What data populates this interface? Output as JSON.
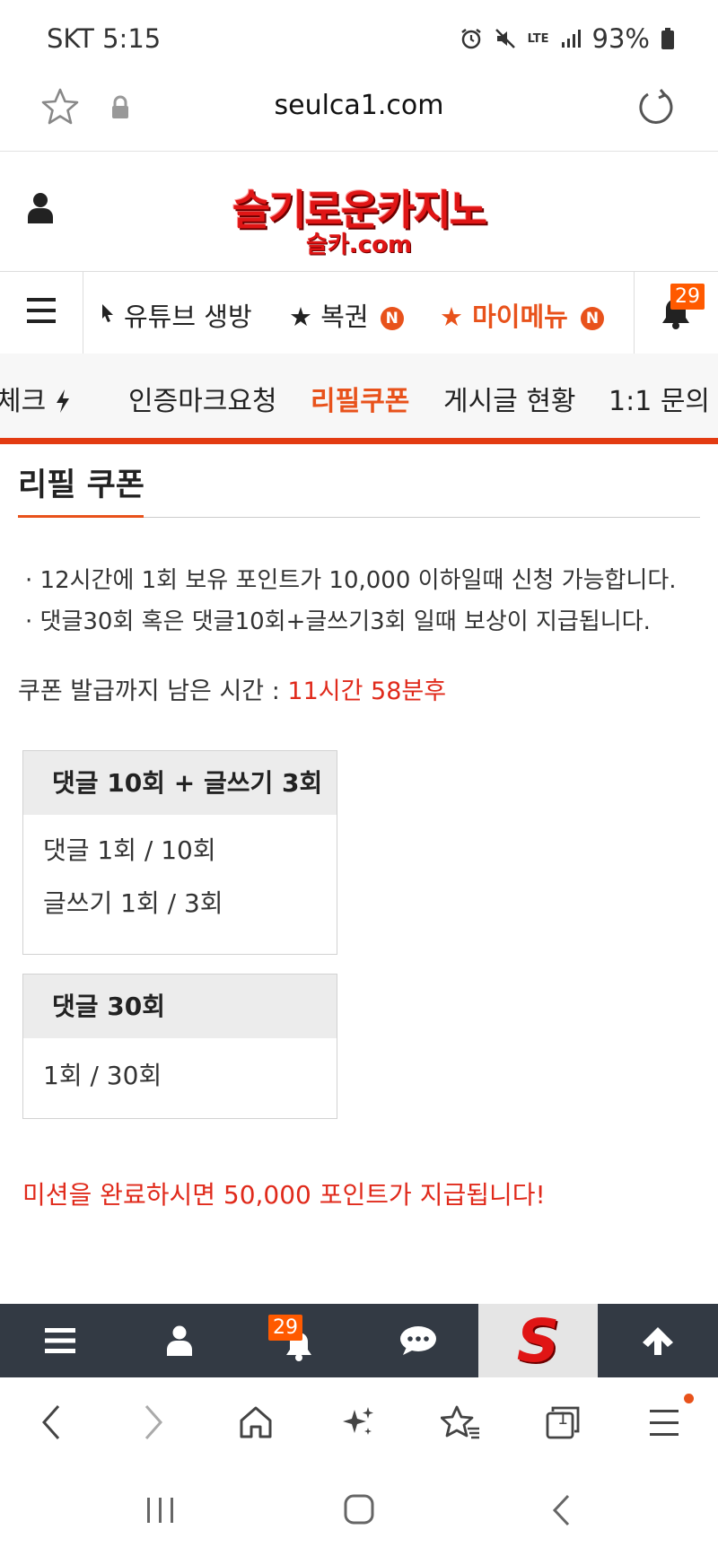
{
  "status": {
    "carrier_time": "SKT 5:15",
    "network": "LTE",
    "battery": "93%"
  },
  "browser": {
    "url": "seulca1.com"
  },
  "site": {
    "logo_main": "슬기로운카지노",
    "logo_sub": "슬카.com"
  },
  "nav1": {
    "items": [
      {
        "label": "유튜브 생방",
        "badge": ""
      },
      {
        "label": "★ 복권",
        "badge": "N"
      },
      {
        "label": "★ 마이메뉴",
        "badge": "N"
      }
    ],
    "notification_count": "29"
  },
  "nav2": {
    "items": [
      "체크",
      "인증마크요청",
      "리필쿠폰",
      "게시글 현황",
      "1:1 문의"
    ],
    "active": "리필쿠폰"
  },
  "page": {
    "title": "리필 쿠폰",
    "info": [
      "· 12시간에 1회 보유 포인트가 10,000 이하일때 신청 가능합니다.",
      "· 댓글30회 혹은 댓글10회+글쓰기3회 일때 보상이 지급됩니다."
    ],
    "remaining_label": "쿠폰 발급까지 남은 시간 : ",
    "remaining_time": "11시간 58분후",
    "boxes": [
      {
        "head": "댓글 10회 + 글쓰기 3회",
        "rows": [
          "댓글 1회 / 10회",
          "글쓰기 1회 / 3회"
        ]
      },
      {
        "head": "댓글 30회",
        "rows": [
          "1회 / 30회"
        ]
      }
    ],
    "mission_text": "미션을 완료하시면 50,000 포인트가 지급됩니다!"
  },
  "bottom_bar": {
    "notification_count": "29",
    "logo_letter": "S"
  },
  "browser_nav": {
    "tab_count": "1"
  },
  "colors": {
    "accent": "#e8521b",
    "red_text": "#e02a1b",
    "bottom_bar": "#333a44"
  }
}
